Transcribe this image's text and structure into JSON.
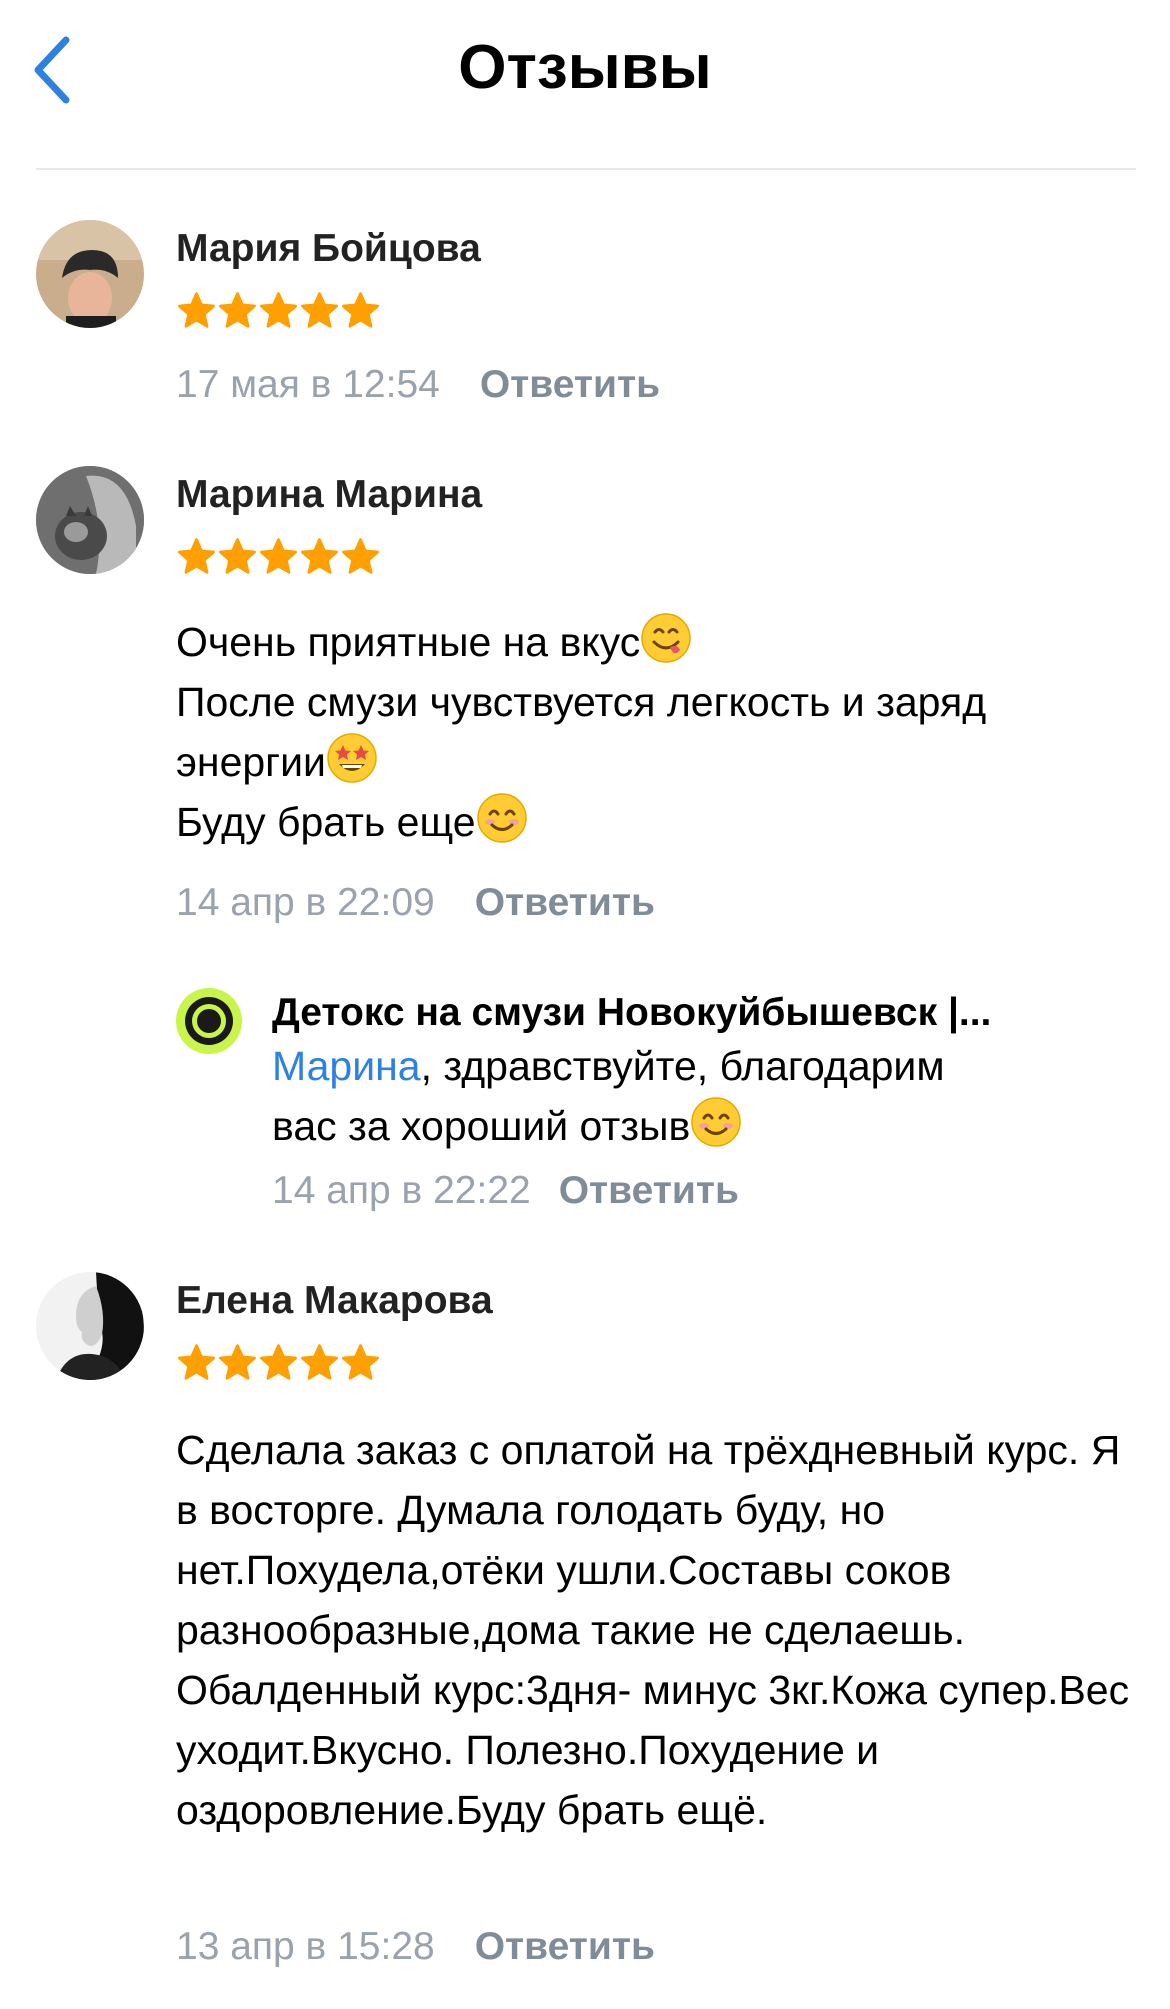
{
  "header": {
    "title": "Отзывы",
    "back_icon": "chevron-left-icon"
  },
  "colors": {
    "accent": "#2d81e0",
    "star": "#ffa000",
    "secondary_text": "#99a2ad",
    "reply_button": "#818c99",
    "group_avatar_ring": "#c9f54b"
  },
  "reviews": [
    {
      "author": "Мария Бойцова",
      "rating": 5,
      "text": "",
      "date": "17 мая в 12:54",
      "reply_label": "Ответить"
    },
    {
      "author": "Марина Марина",
      "rating": 5,
      "text_lines": [
        "Очень приятные на вкус",
        "После смузи чувствуется легкость и заряд",
        "энергии",
        "Буду брать еще"
      ],
      "emojis": [
        "face-savoring-food-emoji",
        "star-struck-emoji",
        "smiling-face-emoji"
      ],
      "date": "14 апр в 22:09",
      "reply_label": "Ответить",
      "reply": {
        "author": "Детокс на смузи Новокуйбышевск |...",
        "mention": "Марина",
        "text_after_mention": ", здравствуйте, благодарим",
        "text_line2": "вас за хороший отзыв",
        "date": "14 апр в 22:22",
        "reply_label": "Ответить"
      }
    },
    {
      "author": "Елена Макарова",
      "rating": 5,
      "text": "Сделала заказ с оплатой на трёхдневный курс. Я в восторге. Думала голодать буду, но нет.Похудела,отёки ушли.Составы соков разнообразные,дома такие не сделаешь. Обалденный курс:3дня- минус 3кг.Кожа супер.Вес уходит.Вкусно. Полезно.Похудение и оздоровление.Буду брать ещё.",
      "date": "13 апр в 15:28",
      "reply_label": "Ответить"
    }
  ]
}
